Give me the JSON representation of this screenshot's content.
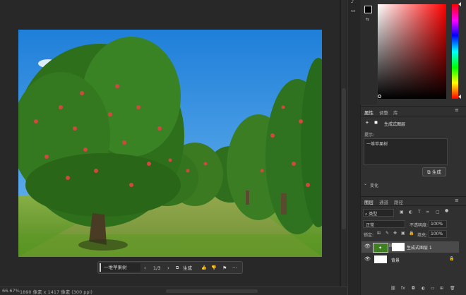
{
  "status": {
    "zoom": "66.67%",
    "doc_info": "1890 像素 x 1417 像素 (300 ppi)"
  },
  "taskbar": {
    "prompt_text": "一堆苹果树",
    "prev_icon": "‹",
    "page_counter": "1/3",
    "next_icon": "›",
    "generate_label": "生成",
    "thumbs_up_icon": "👍",
    "thumbs_down_icon": "👎",
    "flag_icon": "⚑",
    "more_icon": "···"
  },
  "properties": {
    "tabs": [
      "属性",
      "调整",
      "库"
    ],
    "active_tab": "属性",
    "layer_type": "生成式图层",
    "prompt_label": "提示:",
    "prompt_value": "一堆苹果树",
    "generate_button": "生成",
    "variations_label": "变化"
  },
  "layers": {
    "tabs": [
      "图层",
      "通道",
      "路径"
    ],
    "filter_kind": "类型",
    "blend_mode": "正常",
    "opacity_label": "不透明度:",
    "opacity_value": "100%",
    "lock_label": "锁定:",
    "fill_label": "填充:",
    "fill_value": "100%",
    "items": [
      {
        "name": "生成式图层 1",
        "selected": true
      },
      {
        "name": "背景",
        "selected": false
      }
    ]
  },
  "colors": {
    "accent": "#3d6ee8",
    "canvas_bg": "#282828",
    "panel_bg": "#303030"
  }
}
